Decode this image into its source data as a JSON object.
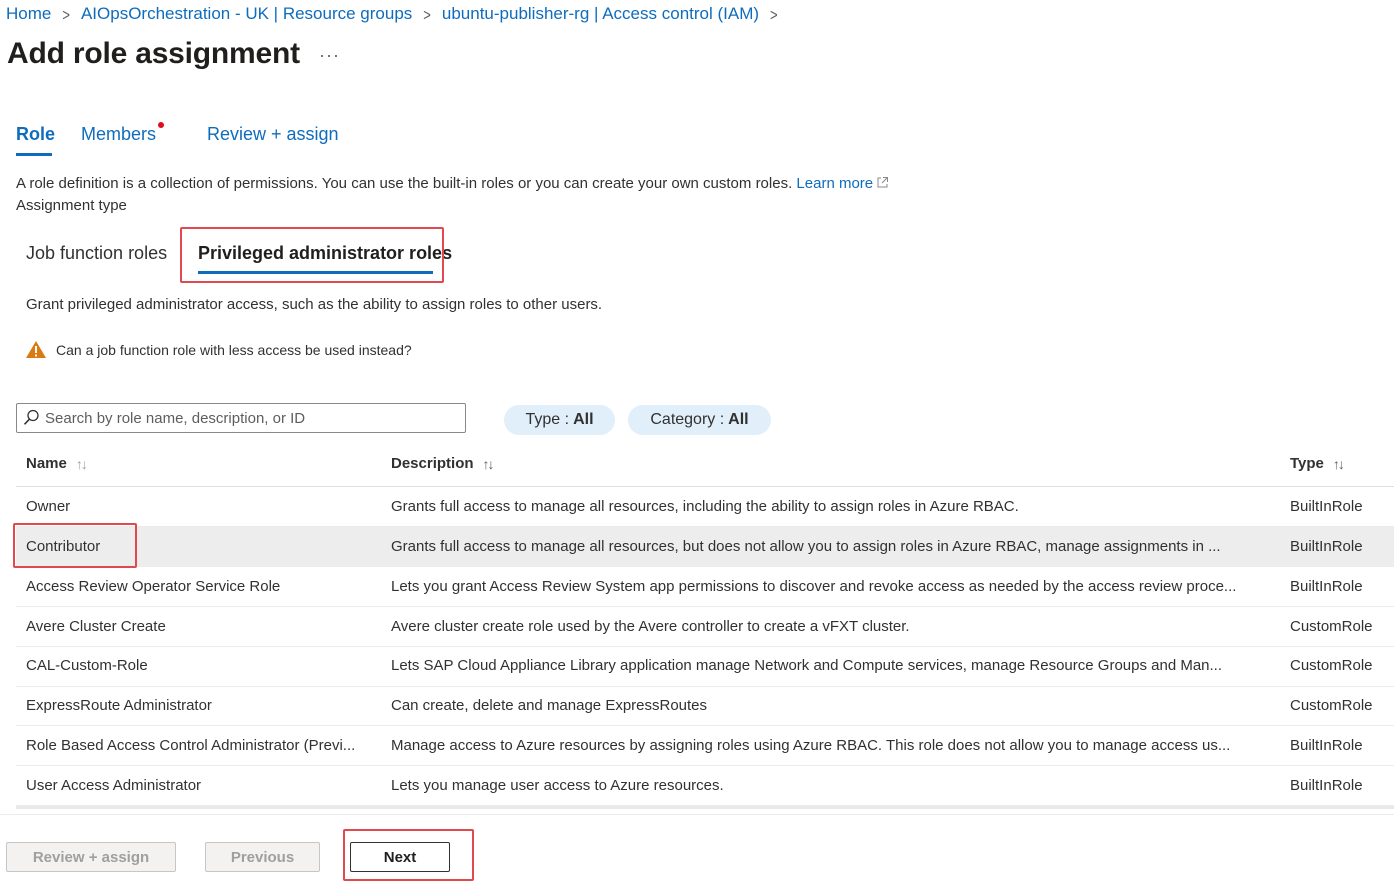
{
  "breadcrumb": [
    {
      "label": "Home"
    },
    {
      "label": "AIOpsOrchestration - UK | Resource groups"
    },
    {
      "label": "ubuntu-publisher-rg | Access control (IAM)"
    }
  ],
  "page": {
    "title": "Add role assignment",
    "more": "···"
  },
  "tabs": {
    "role": "Role",
    "members": "Members",
    "review": "Review + assign"
  },
  "intro": {
    "text": "A role definition is a collection of permissions. You can use the built-in roles or you can create your own custom roles.",
    "learn_more": "Learn more",
    "assignment_type": "Assignment type"
  },
  "subtabs": {
    "job": "Job function roles",
    "privileged": "Privileged administrator roles"
  },
  "grant_text": "Grant privileged administrator access, such as the ability to assign roles to other users.",
  "warning": "Can a job function role with less access be used instead?",
  "search": {
    "placeholder": "Search by role name, description, or ID"
  },
  "filters": {
    "type_label": "Type :",
    "type_value": "All",
    "category_label": "Category :",
    "category_value": "All"
  },
  "table": {
    "columns": {
      "name": "Name",
      "description": "Description",
      "type": "Type"
    },
    "sort_glyph": "↑↓",
    "rows": [
      {
        "name": "Owner",
        "description": "Grants full access to manage all resources, including the ability to assign roles in Azure RBAC.",
        "type": "BuiltInRole"
      },
      {
        "name": "Contributor",
        "description": "Grants full access to manage all resources, but does not allow you to assign roles in Azure RBAC, manage assignments in ...",
        "type": "BuiltInRole"
      },
      {
        "name": "Access Review Operator Service Role",
        "description": "Lets you grant Access Review System app permissions to discover and revoke access as needed by the access review proce...",
        "type": "BuiltInRole"
      },
      {
        "name": "Avere Cluster Create",
        "description": "Avere cluster create role used by the Avere controller to create a vFXT cluster.",
        "type": "CustomRole"
      },
      {
        "name": "CAL-Custom-Role",
        "description": "Lets SAP Cloud Appliance Library application manage Network and Compute services, manage Resource Groups and Man...",
        "type": "CustomRole"
      },
      {
        "name": "ExpressRoute Administrator",
        "description": "Can create, delete and manage ExpressRoutes",
        "type": "CustomRole"
      },
      {
        "name": "Role Based Access Control Administrator (Previ...",
        "description": "Manage access to Azure resources by assigning roles using Azure RBAC. This role does not allow you to manage access us...",
        "type": "BuiltInRole"
      },
      {
        "name": "User Access Administrator",
        "description": "Lets you manage user access to Azure resources.",
        "type": "BuiltInRole"
      }
    ]
  },
  "footer": {
    "review_assign": "Review + assign",
    "previous": "Previous",
    "next": "Next"
  },
  "colors": {
    "link": "#0f6cbd",
    "highlight_box": "#e0494e",
    "warning": "#d97a12",
    "selected_row": "#ededed",
    "pill_bg": "#e1effa"
  }
}
